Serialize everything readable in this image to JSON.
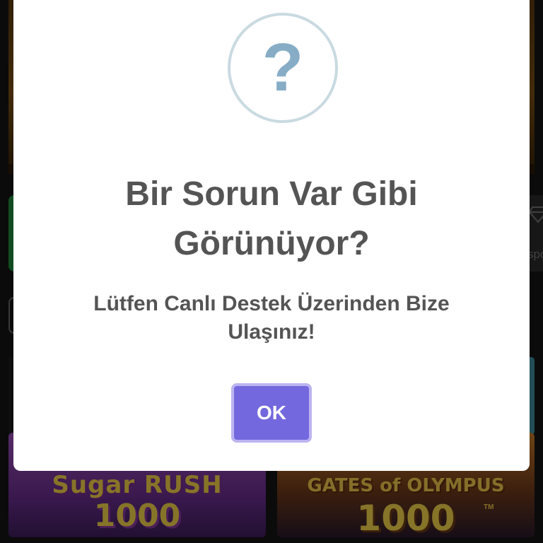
{
  "background": {
    "side_tile_text": "spo",
    "games": [
      {
        "logo_top": "Sugar RUSH",
        "logo_number": "1000"
      },
      {
        "logo_top": "GATES of OLYMPUS",
        "logo_number": "1000",
        "trademark": "TM"
      }
    ]
  },
  "dialog": {
    "icon": "question-icon",
    "icon_glyph": "?",
    "title": "Bir Sorun Var Gibi Görünüyor?",
    "message": "Lütfen Canlı Destek Üzerinden Bize Ulaşınız!",
    "ok_label": "OK"
  },
  "colors": {
    "button": "#7468de",
    "button_border": "#bcb4f1",
    "icon_ring": "#c9dae1",
    "icon_glyph": "#87adc6",
    "text": "#545454"
  }
}
